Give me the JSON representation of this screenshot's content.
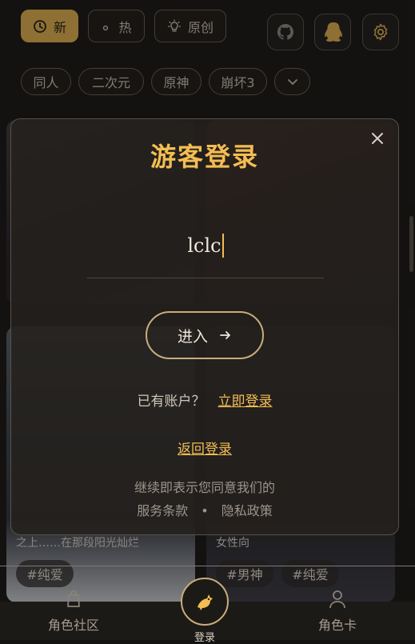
{
  "filters": [
    {
      "label": "新",
      "icon": "clock-icon",
      "active": true
    },
    {
      "label": "热",
      "icon": "flame-icon",
      "active": false
    },
    {
      "label": "原创",
      "icon": "lightbulb-icon",
      "active": false
    }
  ],
  "header_icons": [
    "github-icon",
    "penguin-icon",
    "gear-icon"
  ],
  "tags": [
    "同人",
    "二次元",
    "原神",
    "崩坏3"
  ],
  "modal": {
    "title": "游客登录",
    "input_value": "lclc",
    "enter_label": "进入",
    "has_account_text": "已有账户？",
    "login_now": "立即登录",
    "back_login": "返回登录",
    "terms_text": "继续即表示您同意我们的",
    "service_terms": "服务条款",
    "separator": "•",
    "privacy_policy": "隐私政策"
  },
  "cards": {
    "caption_left": "之上……在那段阳光灿烂",
    "caption_right": "女性向",
    "hashtags_left": [
      "#纯爱"
    ],
    "hashtags_right": [
      "#男神",
      "#纯爱"
    ]
  },
  "bottom_nav": {
    "left": "角色社区",
    "center": "登录",
    "right": "角色卡"
  },
  "colors": {
    "accent": "#f3bd52",
    "background": "#151311",
    "modal": "#24211d"
  }
}
